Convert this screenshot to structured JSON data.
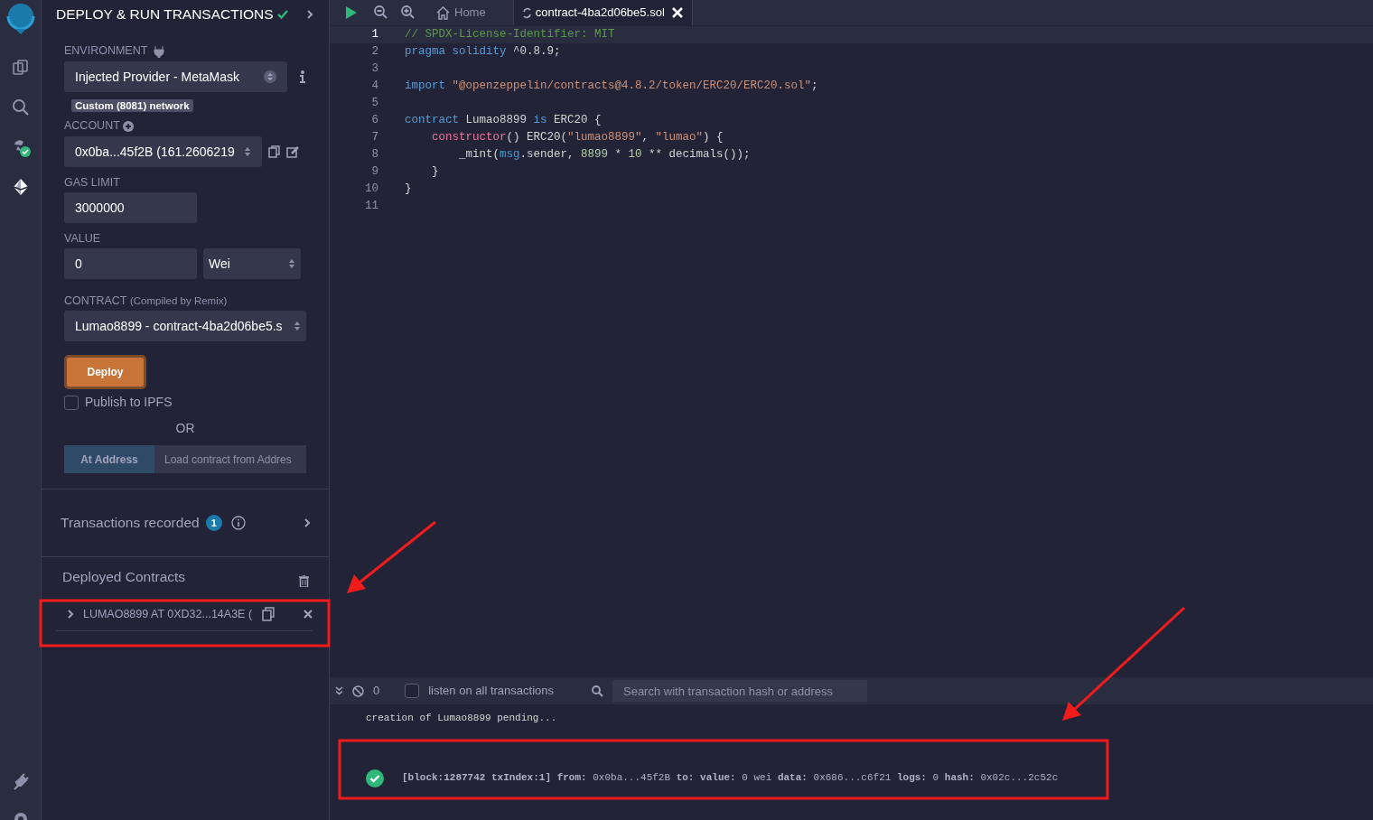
{
  "panel": {
    "title": "DEPLOY & RUN TRANSACTIONS",
    "environment": {
      "label": "ENVIRONMENT",
      "value": "Injected Provider - MetaMask",
      "network": "Custom (8081) network"
    },
    "account": {
      "label": "ACCOUNT",
      "value": "0x0ba...45f2B (161.2606219"
    },
    "gas_limit": {
      "label": "GAS LIMIT",
      "value": "3000000"
    },
    "value": {
      "label": "VALUE",
      "amount": "0",
      "unit": "Wei"
    },
    "contract": {
      "label": "CONTRACT",
      "note": "(Compiled by Remix)",
      "value": "Lumao8899 - contract-4ba2d06be5.s"
    },
    "deploy_button": "Deploy",
    "publish": {
      "label": "Publish to IPFS",
      "checked": false
    },
    "or": "OR",
    "at_address_button": "At Address",
    "address_placeholder": "Load contract from Addres",
    "transactions": {
      "label": "Transactions recorded",
      "count": "1"
    },
    "deployed": {
      "title": "Deployed Contracts",
      "items": [
        {
          "label": "LUMAO8899 AT 0XD32...14A3E (",
          "expanded": false
        }
      ]
    }
  },
  "editor": {
    "tabs": [
      {
        "label": "Home",
        "kind": "home",
        "selected": false
      },
      {
        "label": "contract-4ba2d06be5.sol",
        "kind": "file",
        "selected": true
      }
    ],
    "lines": [
      {
        "number": "1",
        "selected": true,
        "tokens": [
          {
            "kind": "comment",
            "text": "// SPDX-License-Identifier: MIT"
          }
        ]
      },
      {
        "number": "2",
        "selected": false,
        "tokens": [
          {
            "kind": "keyword",
            "text": "pragma solidity"
          },
          {
            "kind": "plain",
            "text": " ^0.8.9;"
          }
        ]
      },
      {
        "number": "3",
        "selected": false
      },
      {
        "number": "4",
        "selected": false,
        "tokens": [
          {
            "kind": "keyword",
            "text": "import"
          },
          {
            "kind": "string",
            "text": " \"@openzeppelin/contracts@4.8.2/token/ERC20/ERC20.sol\""
          },
          {
            "kind": "plain",
            "text": ";"
          }
        ]
      },
      {
        "number": "5",
        "selected": false
      },
      {
        "number": "6",
        "selected": false,
        "tokens": [
          {
            "kind": "keyword",
            "text": "contract"
          },
          {
            "kind": "plain",
            "text": " Lumao8899 "
          },
          {
            "kind": "keyword",
            "text": "is"
          },
          {
            "kind": "plain",
            "text": " ERC20 {"
          }
        ],
        "children": [
          {
            "number": "7",
            "selected": false,
            "tokens": [
              {
                "kind": "special",
                "text": "constructor"
              },
              {
                "kind": "plain",
                "text": "() ERC20("
              },
              {
                "kind": "string",
                "text": "\"lumao8899\""
              },
              {
                "kind": "plain",
                "text": ", "
              },
              {
                "kind": "string",
                "text": "\"lumao\""
              },
              {
                "kind": "plain",
                "text": ") {"
              }
            ],
            "children": [
              {
                "number": "8",
                "selected": false,
                "tokens": [
                  {
                    "kind": "plain",
                    "text": "_mint("
                  },
                  {
                    "kind": "global",
                    "text": "msg"
                  },
                  {
                    "kind": "plain",
                    "text": ".sender, "
                  },
                  {
                    "kind": "number",
                    "text": "8899"
                  },
                  {
                    "kind": "plain",
                    "text": " * "
                  },
                  {
                    "kind": "number",
                    "text": "10"
                  },
                  {
                    "kind": "plain",
                    "text": " ** decimals());"
                  }
                ]
              }
            ]
          },
          {
            "number": "9",
            "selected": false,
            "tokens": [
              {
                "kind": "plain",
                "text": "}"
              }
            ]
          }
        ]
      },
      {
        "number": "10",
        "selected": false,
        "tokens": [
          {
            "kind": "plain",
            "text": "}"
          }
        ]
      },
      {
        "number": "11",
        "selected": false
      }
    ]
  },
  "terminal": {
    "count": "0",
    "listen": {
      "label": "listen on all transactions",
      "checked": false
    },
    "search_placeholder": "Search with transaction hash or address",
    "log": [
      "creation of Lumao8899 pending..."
    ],
    "transaction": {
      "success": true,
      "text": "**[block:1287742 txIndex:1]  from:** 0x0ba...45f2B **to:**  **value:** 0 wei **data:** 0x686...c6f21 **logs:** 0 **hash:** 0x02c...2c52c"
    }
  }
}
